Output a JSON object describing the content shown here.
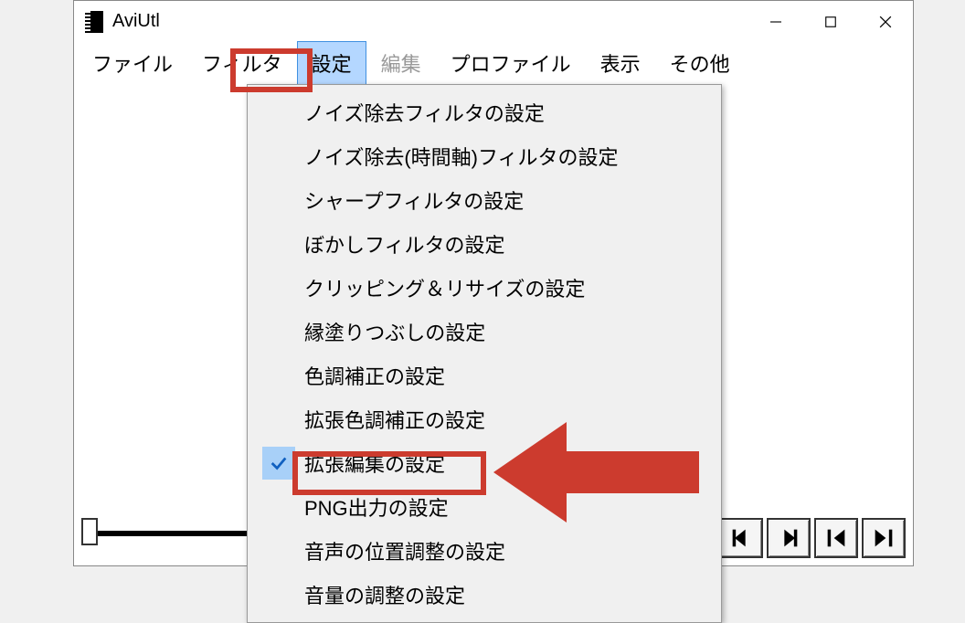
{
  "titlebar": {
    "app_title": "AviUtl"
  },
  "menubar": {
    "items": [
      "ファイル",
      "フィルタ",
      "設定",
      "編集",
      "プロファイル",
      "表示",
      "その他"
    ]
  },
  "dropdown": {
    "items": [
      {
        "label": "ノイズ除去フィルタの設定",
        "checked": false
      },
      {
        "label": "ノイズ除去(時間軸)フィルタの設定",
        "checked": false
      },
      {
        "label": "シャープフィルタの設定",
        "checked": false
      },
      {
        "label": "ぼかしフィルタの設定",
        "checked": false
      },
      {
        "label": "クリッピング＆リサイズの設定",
        "checked": false
      },
      {
        "label": "縁塗りつぶしの設定",
        "checked": false
      },
      {
        "label": "色調補正の設定",
        "checked": false
      },
      {
        "label": "拡張色調補正の設定",
        "checked": false
      },
      {
        "label": "拡張編集の設定",
        "checked": true
      },
      {
        "label": "PNG出力の設定",
        "checked": false
      },
      {
        "label": "音声の位置調整の設定",
        "checked": false
      },
      {
        "label": "音量の調整の設定",
        "checked": false
      }
    ]
  }
}
